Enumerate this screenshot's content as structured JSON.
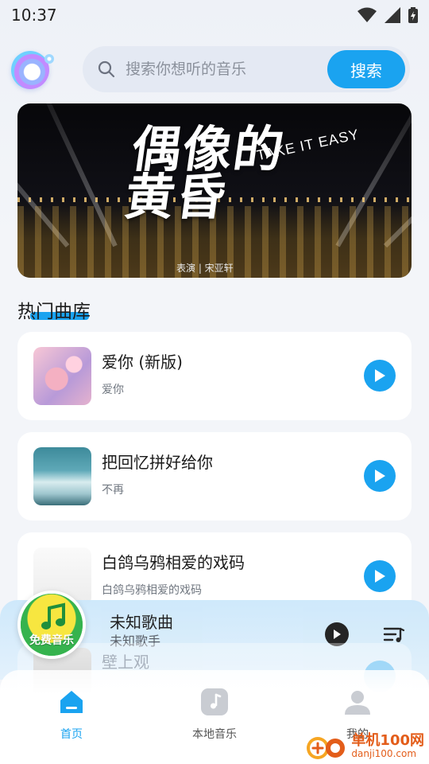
{
  "status_bar": {
    "time": "10:37"
  },
  "search": {
    "placeholder": "搜索你想听的音乐",
    "button_label": "搜索"
  },
  "banner": {
    "title": "偶像的黄昏",
    "subtitle": "TAKE IT EASY",
    "credit": "表演 | 宋亚轩"
  },
  "section": {
    "title": "热门曲库"
  },
  "songs": [
    {
      "title": "爱你 (新版)",
      "artist": "爱你"
    },
    {
      "title": "把回忆拼好给你",
      "artist": "不再"
    },
    {
      "title": "白鸽乌鸦相爱的戏码",
      "artist": "白鸽乌鸦相爱的戏码"
    },
    {
      "title": "壁上观",
      "artist": ""
    }
  ],
  "player": {
    "title": "未知歌曲",
    "artist": "未知歌手",
    "badge": "免费音乐"
  },
  "nav": {
    "home": "首页",
    "local": "本地音乐",
    "mine": "我的"
  },
  "watermark": {
    "main": "单机100网",
    "sub": "danji100.com"
  },
  "colors": {
    "accent": "#1aa3f0"
  }
}
